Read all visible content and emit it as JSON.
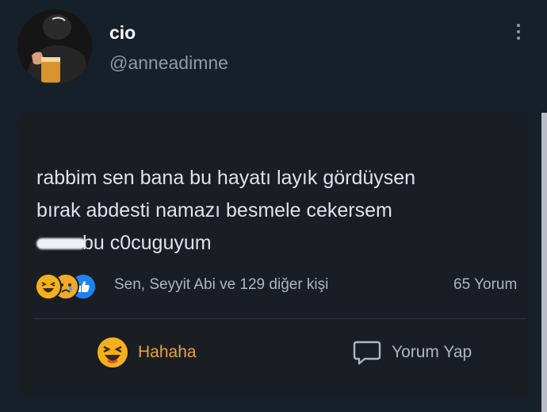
{
  "user": {
    "display_name": "cio",
    "handle": "@anneadimne",
    "avatar_icon": "profile-photo"
  },
  "menu_icon": "more-vertical-icon",
  "post": {
    "line1": "rabbim sen bana bu hayatı layık gördüysen",
    "line2": "bırak abdesti namazı besmele cekersem",
    "line3_suffix": "bu c0cuguyum",
    "reactions": [
      "haha-emoji",
      "sad-emoji",
      "like-icon"
    ],
    "reaction_summary": "Sen, Seyyit Abi ve 129 diğer kişi",
    "comment_count": "65 Yorum",
    "haha_button_label": "Hahaha",
    "comment_button_label": "Yorum Yap"
  },
  "colors": {
    "page_bg": "#16202b",
    "card_bg": "#1a1e23",
    "haha_accent": "#e9a23b",
    "like_blue": "#1d83f2"
  }
}
